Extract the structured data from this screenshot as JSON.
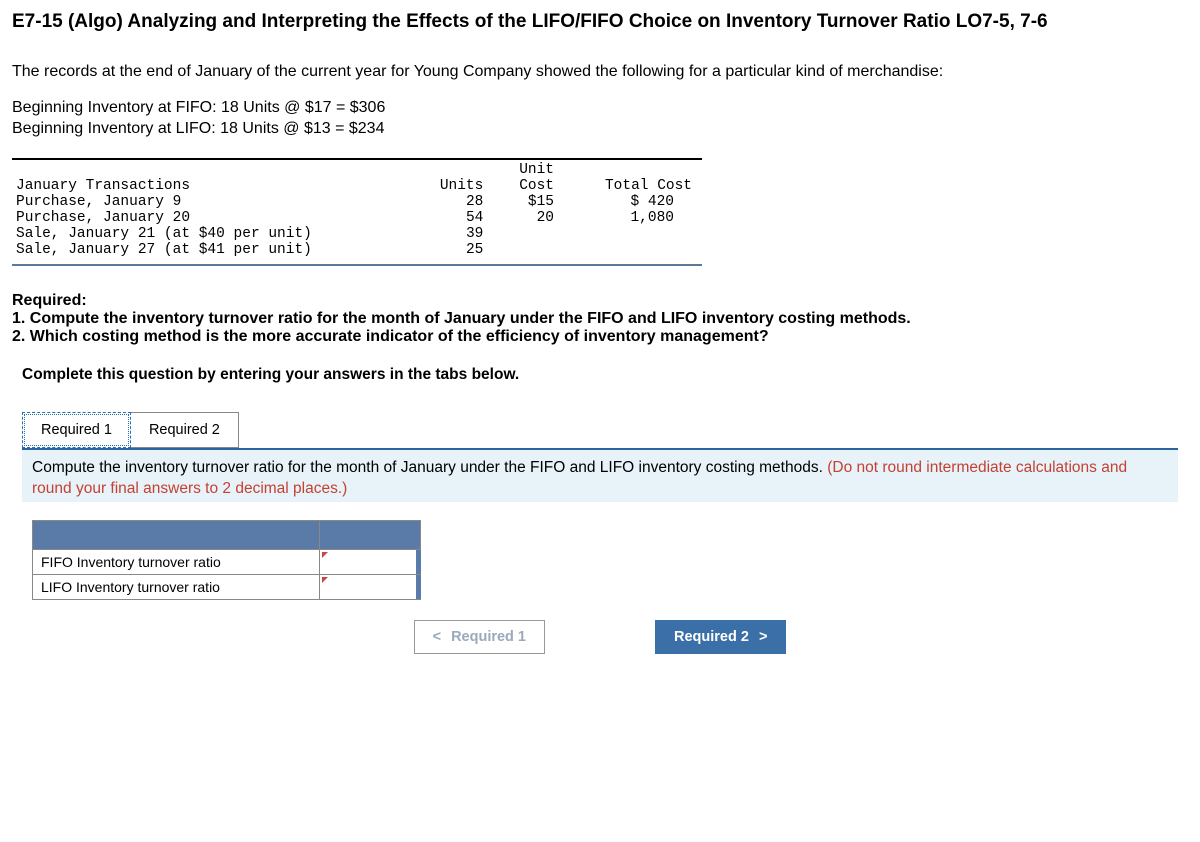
{
  "title": "E7-15 (Algo) Analyzing and Interpreting the Effects of the LIFO/FIFO Choice on Inventory Turnover Ratio LO7-5, 7-6",
  "intro": "The records at the end of January of the current year for Young Company showed the following for a particular kind of merchandise:",
  "beginning": {
    "fifo": "Beginning Inventory at FIFO: 18 Units @ $17 = $306",
    "lifo": "Beginning Inventory at LIFO: 18 Units @ $13 = $234"
  },
  "trans_table": {
    "headers": {
      "c0": "January  Transactions",
      "c1": "Units",
      "c2_top": "Unit",
      "c2_bot": "Cost",
      "c3": "Total Cost"
    },
    "rows": [
      {
        "label": "Purchase, January 9",
        "units": "28",
        "unit_cost": "$15",
        "total": "$  420"
      },
      {
        "label": "Purchase, January 20",
        "units": "54",
        "unit_cost": "20",
        "total": "1,080"
      },
      {
        "label": "Sale, January 21 (at $40 per unit)",
        "units": "39",
        "unit_cost": "",
        "total": ""
      },
      {
        "label": "Sale, January 27 (at $41 per unit)",
        "units": "25",
        "unit_cost": "",
        "total": ""
      }
    ]
  },
  "required": {
    "heading": "Required:",
    "line1": "1. Compute the inventory turnover ratio for the month of January under the FIFO and LIFO inventory costing methods.",
    "line2": "2. Which costing method is the more accurate indicator of the efficiency of inventory management?"
  },
  "complete_line": "Complete this question by entering your answers in the tabs below.",
  "tabs": {
    "t1": "Required 1",
    "t2": "Required 2"
  },
  "tab_body": {
    "main": "Compute the inventory turnover ratio for the month of January under the FIFO and LIFO inventory costing methods. ",
    "red": "(Do not round intermediate calculations and round your final answers to 2 decimal places.)"
  },
  "answer_table": {
    "row1": "FIFO Inventory turnover ratio",
    "row2": "LIFO Inventory turnover ratio"
  },
  "nav": {
    "prev_chev": "<",
    "prev": "Required 1",
    "next": "Required 2",
    "next_chev": ">"
  }
}
